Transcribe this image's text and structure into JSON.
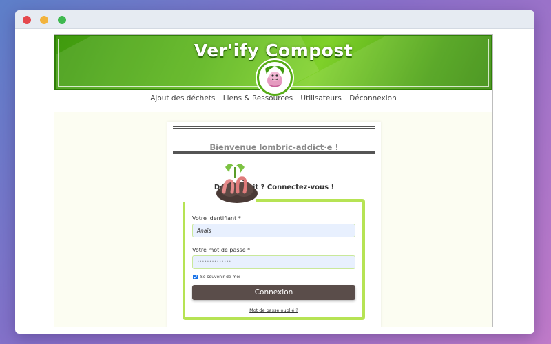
{
  "window": {
    "controls": [
      "close",
      "minimize",
      "maximize"
    ]
  },
  "header": {
    "brand": "Ver'ify Compost",
    "logo_icon": "worm-mascot-icon"
  },
  "nav": {
    "items": [
      {
        "label": "Ajout des déchets"
      },
      {
        "label": "Liens & Ressources"
      },
      {
        "label": "Utilisateurs"
      },
      {
        "label": "Déconnexion"
      }
    ]
  },
  "login": {
    "welcome": "Bienvenue lombric-addict·e !",
    "heading": "Déjà inscrit ? Connectez-vous !",
    "username_label": "Votre identifiant *",
    "username_value": "Anaïs",
    "password_label": "Votre mot de passe *",
    "password_value": "••••••••••••••",
    "remember_label": "Se souvenir de moi",
    "remember_checked": true,
    "submit_label": "Connexion",
    "forgot_link": "Mot de passe oublié ?"
  },
  "colors": {
    "brand_green": "#56ac16",
    "form_border": "#b6e354",
    "button": "#5a4d4a",
    "page_bg": "#fcfdf2"
  }
}
